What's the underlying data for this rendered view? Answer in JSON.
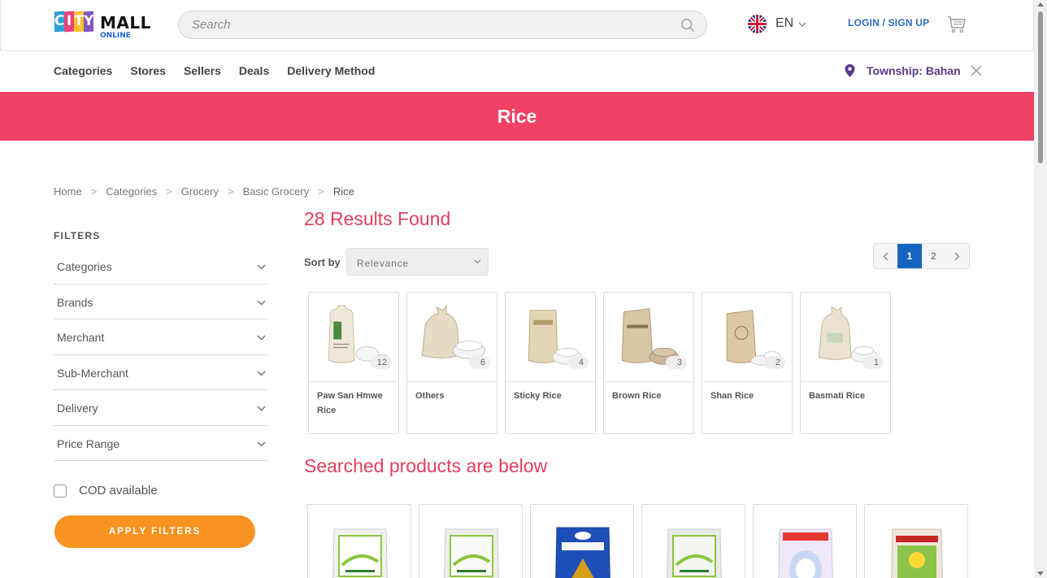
{
  "header": {
    "logo": {
      "city_letters": [
        "C",
        "I",
        "T",
        "Y"
      ],
      "city_colors": [
        "#2a9fd8",
        "#ec407a",
        "#fbc02d",
        "#7e57c2"
      ],
      "mall": "MALL",
      "online": "ONLINE"
    },
    "search": {
      "placeholder": "Search",
      "icon": "search-icon"
    },
    "language": {
      "flag": "uk-flag-icon",
      "label": "EN",
      "icon": "chevron-down-icon"
    },
    "login_label": "LOGIN / SIGN UP",
    "cart_icon": "cart-icon"
  },
  "nav": {
    "items": [
      "Categories",
      "Stores",
      "Sellers",
      "Deals",
      "Delivery Method"
    ],
    "township_label": "Township: Bahan",
    "pin_icon": "location-pin-icon",
    "close_icon": "close-icon"
  },
  "banner": {
    "title": "Rice",
    "color": "#ef4264"
  },
  "breadcrumb": {
    "items": [
      "Home",
      "Categories",
      "Grocery",
      "Basic Grocery"
    ],
    "separator": ">",
    "current": "Rice"
  },
  "filters": {
    "title": "FILTERS",
    "items": [
      "Categories",
      "Brands",
      "Merchant",
      "Sub-Merchant",
      "Delivery",
      "Price Range"
    ],
    "cod_label": "COD available",
    "apply_label": "APPLY FILTERS"
  },
  "results": {
    "count_label": "28 Results Found",
    "sort_label": "Sort by",
    "sort_value": "Relevance",
    "pagination": {
      "pages": [
        "1",
        "2"
      ],
      "current": "1"
    }
  },
  "categories": [
    {
      "name": "Paw San Hmwe Rice",
      "count": "12"
    },
    {
      "name": "Others",
      "count": "6"
    },
    {
      "name": "Sticky Rice",
      "count": "4"
    },
    {
      "name": "Brown Rice",
      "count": "3"
    },
    {
      "name": "Shan Rice",
      "count": "2"
    },
    {
      "name": "Basmati Rice",
      "count": "1"
    }
  ],
  "products_heading": "Searched products are below",
  "product_images": [
    "rice-bag-green",
    "rice-bag-green",
    "rice-bag-blue",
    "rice-bag-green",
    "rice-bag-pink",
    "rice-bag-beige"
  ],
  "colors": {
    "accent": "#ef4264",
    "button": "#f7931e",
    "link": "#2d6bbf",
    "pager_active": "#1565c0"
  }
}
